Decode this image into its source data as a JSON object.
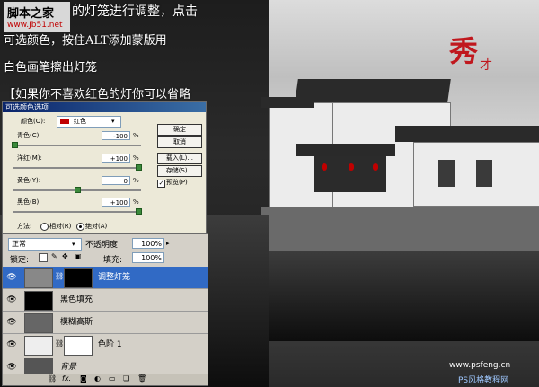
{
  "watermark_top": {
    "site_name": "脚本之家",
    "url": "www.Jb51.net"
  },
  "watermark_bottom": {
    "url": "www.psfeng.cn",
    "brand": "PS风格教程网"
  },
  "seal_logo": {
    "char": "秀",
    "sub": "才"
  },
  "annotation": {
    "line1": "的灯笼进行调整，点击",
    "line2": "可选颜色，按住ALT添加蒙版用",
    "line3": "白色画笔擦出灯笼",
    "line4": "【如果你不喜欢红色的灯你可以省略"
  },
  "dialog": {
    "title": "可选颜色选项",
    "color_label": "颜色(O):",
    "color_value": "红色",
    "color_swatch": "#c00000",
    "buttons": {
      "ok": "确定",
      "cancel": "取消",
      "load": "载入(L)...",
      "save": "存储(S)..."
    },
    "preview_label": "预览(P)",
    "preview_checked": true,
    "sliders": [
      {
        "label": "青色(C):",
        "value": "-100",
        "unit": "%",
        "level": 0.0
      },
      {
        "label": "洋红(M):",
        "value": "+100",
        "unit": "%",
        "level": 1.0
      },
      {
        "label": "黄色(Y):",
        "value": "0",
        "unit": "%",
        "level": 0.5
      },
      {
        "label": "黑色(B):",
        "value": "+100",
        "unit": "%",
        "level": 1.0
      }
    ],
    "method_label": "方法:",
    "method_options": [
      "相对(R)",
      "绝对(A)"
    ],
    "method_selected": 1
  },
  "layers_panel": {
    "blend_mode": "正常",
    "opacity_label": "不透明度:",
    "opacity_value": "100%",
    "lock_label": "锁定:",
    "fill_label": "填充:",
    "fill_value": "100%",
    "layers": [
      {
        "name": "调整灯笼",
        "selected": true
      },
      {
        "name": "黑色填充",
        "selected": false
      },
      {
        "name": "模糊高斯",
        "selected": false
      },
      {
        "name": "色阶 1",
        "selected": false
      },
      {
        "name": "背景",
        "selected": false
      }
    ],
    "footer_fx": "fx."
  },
  "colors": {
    "selection": "#316ac5",
    "dialog_bg": "#ece9d8",
    "panel_bg": "#d4d0c8",
    "seal_red": "#c0181e"
  }
}
